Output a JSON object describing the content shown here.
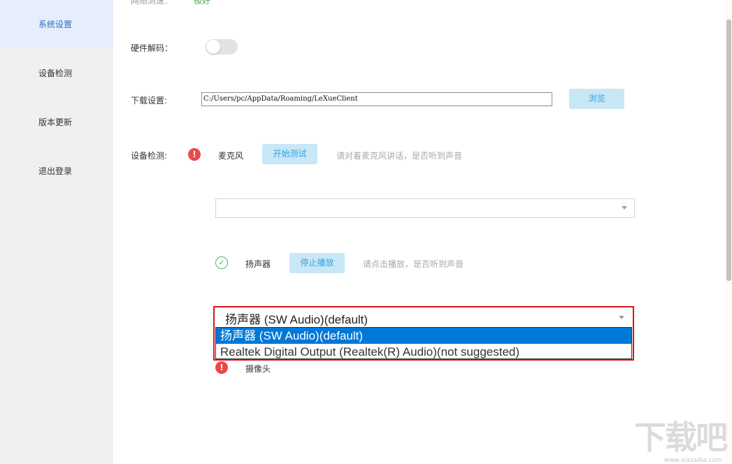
{
  "sidebar": {
    "items": [
      {
        "label": "系统设置",
        "active": true
      },
      {
        "label": "设备检测",
        "active": false
      },
      {
        "label": "版本更新",
        "active": false
      },
      {
        "label": "退出登录",
        "active": false
      }
    ]
  },
  "top_cut": {
    "label": "网络测速：",
    "value": "极好"
  },
  "hardware_decode": {
    "label": "硬件解码：",
    "enabled": false
  },
  "download": {
    "label": "下载设置:",
    "path": "C:/Users/pc/AppData/Roaming/LeXueClient",
    "browse_label": "浏览"
  },
  "device_check": {
    "label": "设备检测:",
    "microphone": {
      "name": "麦克风",
      "status_icon": "error-icon",
      "button_label": "开始测试",
      "hint": "请对着麦克风讲话，是否听到声音",
      "selected_device": ""
    },
    "speaker": {
      "name": "扬声器",
      "status_icon": "check-icon",
      "button_label": "停止播放",
      "hint": "请点击播放，是否听到声音",
      "selected_device": "扬声器 (SW Audio)(default)",
      "options": [
        {
          "label": "扬声器 (SW Audio)(default)",
          "selected": true
        },
        {
          "label": "Realtek Digital Output (Realtek(R) Audio)(not suggested)",
          "selected": false
        }
      ]
    },
    "camera": {
      "name": "摄像头",
      "status_icon": "error-icon"
    }
  },
  "colors": {
    "accent": "#2f6ec6",
    "button_bg": "#c8e7f7",
    "button_text": "#36a2dd",
    "error": "#e84a4a",
    "ok": "#3cbc6e",
    "highlight_border": "#d9141b",
    "selected_option": "#0078d7"
  },
  "watermark": {
    "text": "下载吧",
    "url_text": "www.xiazaiba.com"
  }
}
